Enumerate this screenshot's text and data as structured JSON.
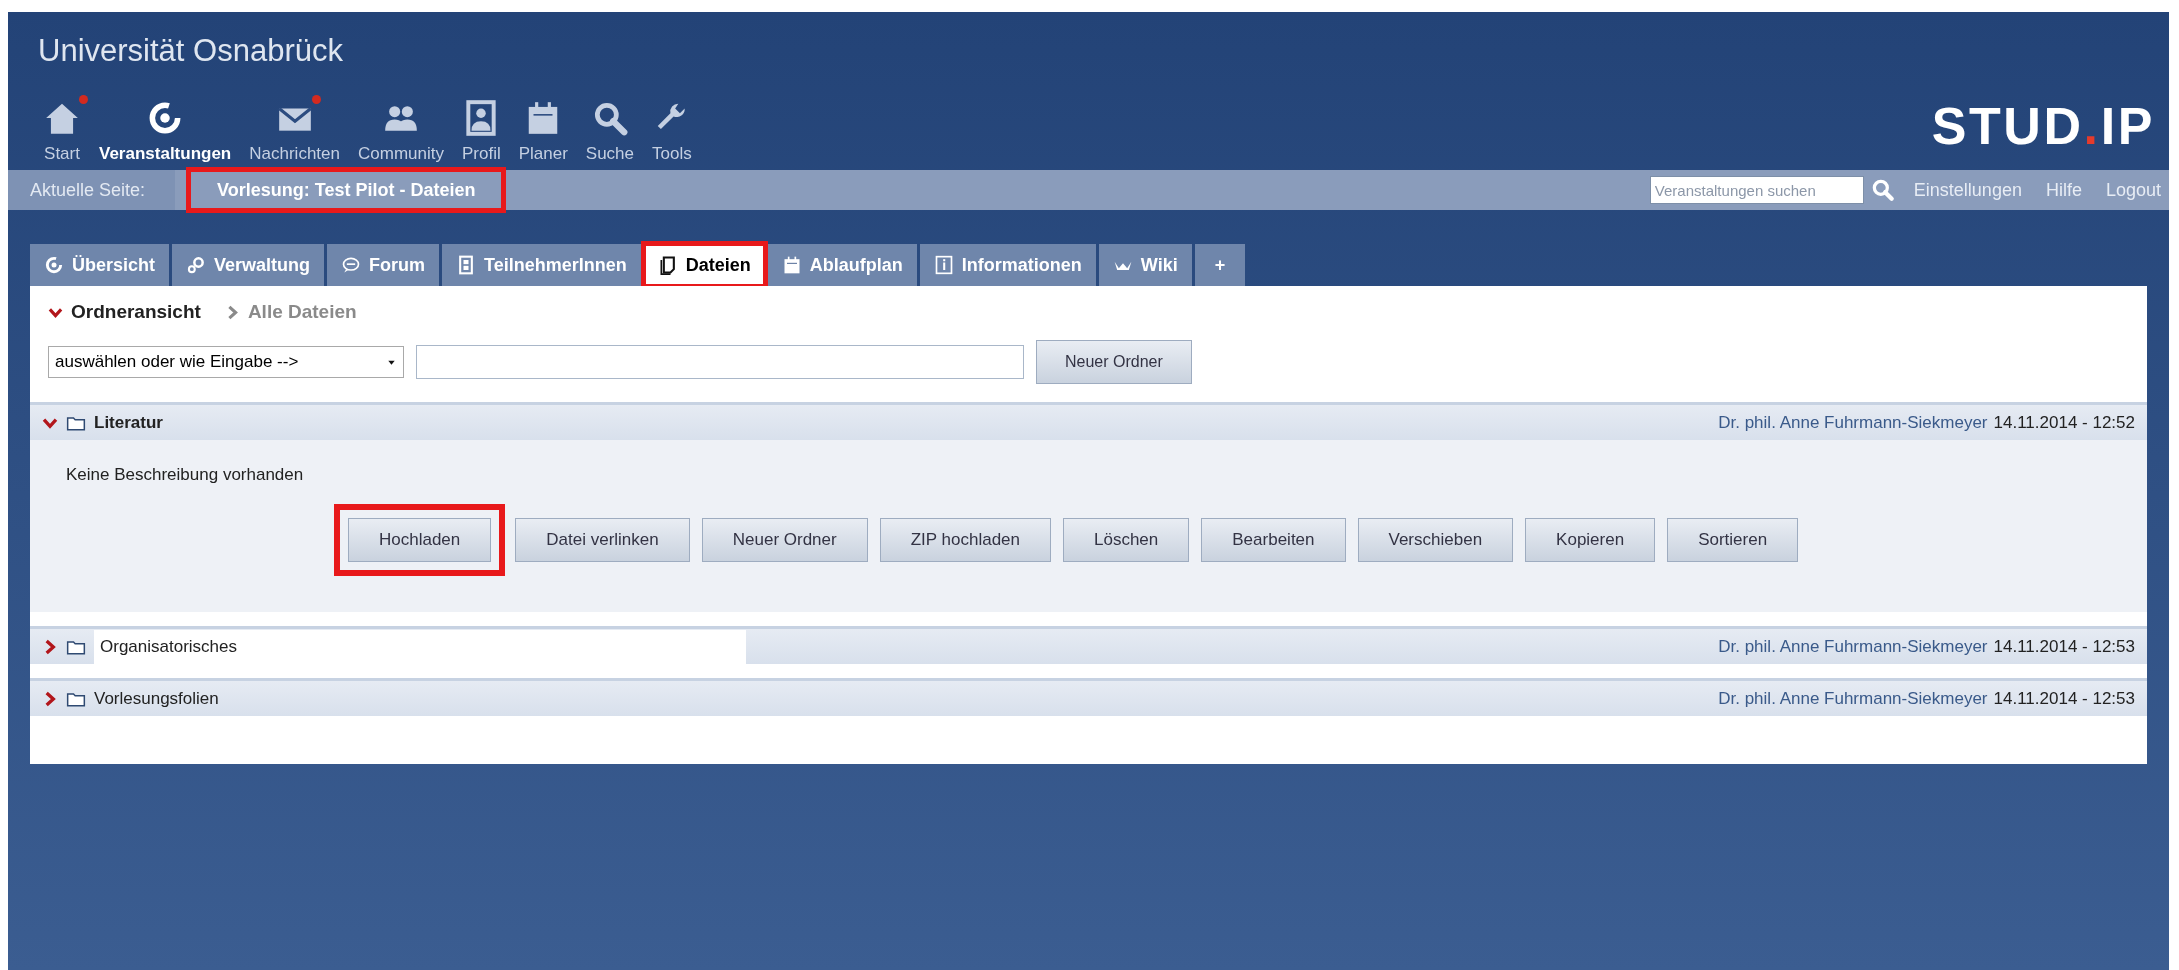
{
  "header": {
    "title": "Universität Osnabrück",
    "logo": {
      "left": "STUD",
      "dot": ".",
      "right": "IP"
    }
  },
  "nav": [
    {
      "kind": "home",
      "label": "Start",
      "selected": false,
      "badge": true
    },
    {
      "kind": "target",
      "label": "Veranstaltungen",
      "selected": true,
      "badge": false
    },
    {
      "kind": "mail",
      "label": "Nachrichten",
      "selected": false,
      "badge": true
    },
    {
      "kind": "people",
      "label": "Community",
      "selected": false,
      "badge": false
    },
    {
      "kind": "profile",
      "label": "Profil",
      "selected": false,
      "badge": false
    },
    {
      "kind": "calendar",
      "label": "Planer",
      "selected": false,
      "badge": false
    },
    {
      "kind": "search",
      "label": "Suche",
      "selected": false,
      "badge": false
    },
    {
      "kind": "wrench",
      "label": "Tools",
      "selected": false,
      "badge": false
    }
  ],
  "breadcrumb": {
    "label": "Aktuelle Seite:",
    "current": "Vorlesung: Test Pilot - Dateien",
    "highlighted": true
  },
  "search": {
    "placeholder": "Veranstaltungen suchen"
  },
  "links": [
    "Einstellungen",
    "Hilfe",
    "Logout"
  ],
  "tabs": [
    {
      "kind": "target",
      "label": "Übersicht",
      "selected": false,
      "highlighted": false
    },
    {
      "kind": "gears",
      "label": "Verwaltung",
      "selected": false,
      "highlighted": false
    },
    {
      "kind": "bubble",
      "label": "Forum",
      "selected": false,
      "highlighted": false
    },
    {
      "kind": "person",
      "label": "TeilnehmerInnen",
      "selected": false,
      "highlighted": false
    },
    {
      "kind": "files",
      "label": "Dateien",
      "selected": true,
      "highlighted": true
    },
    {
      "kind": "calendar",
      "label": "Ablaufplan",
      "selected": false,
      "highlighted": false
    },
    {
      "kind": "info",
      "label": "Informationen",
      "selected": false,
      "highlighted": false
    },
    {
      "kind": "wiki",
      "label": "Wiki",
      "selected": false,
      "highlighted": false
    },
    {
      "kind": "plus",
      "label": "+",
      "selected": false,
      "highlighted": false
    }
  ],
  "subnav": [
    {
      "label": "Ordneransicht",
      "selected": true
    },
    {
      "label": "Alle Dateien",
      "selected": false
    }
  ],
  "new_folder": {
    "select": "auswählen oder wie Eingabe -->",
    "button": "Neuer Ordner"
  },
  "folders": [
    {
      "title": "Literatur",
      "expanded": true,
      "editing": false,
      "author": "Dr. phil. Anne Fuhrmann-Siekmeyer",
      "date": "14.11.2014 - 12:52",
      "description": "Keine Beschreibung vorhanden",
      "actions": [
        {
          "label": "Hochladen",
          "highlighted": true
        },
        {
          "label": "Datei verlinken",
          "highlighted": false
        },
        {
          "label": "Neuer Ordner",
          "highlighted": false
        },
        {
          "label": "ZIP hochladen",
          "highlighted": false
        },
        {
          "label": "Löschen",
          "highlighted": false
        },
        {
          "label": "Bearbeiten",
          "highlighted": false
        },
        {
          "label": "Verschieben",
          "highlighted": false
        },
        {
          "label": "Kopieren",
          "highlighted": false
        },
        {
          "label": "Sortieren",
          "highlighted": false
        }
      ]
    },
    {
      "title": "Organisatorisches",
      "expanded": false,
      "editing": true,
      "author": "Dr. phil. Anne Fuhrmann-Siekmeyer",
      "date": "14.11.2014 - 12:53"
    },
    {
      "title": "Vorlesungsfolien",
      "expanded": false,
      "editing": false,
      "author": "Dr. phil. Anne Fuhrmann-Siekmeyer",
      "date": "14.11.2014 - 12:53"
    }
  ]
}
